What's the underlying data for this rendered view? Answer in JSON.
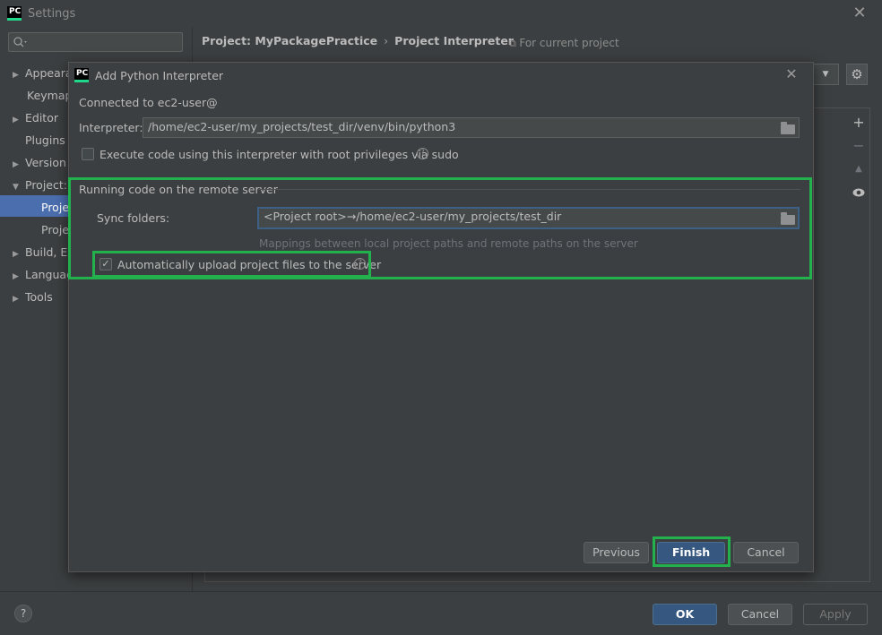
{
  "window": {
    "logo_text": "PC",
    "title": "Settings",
    "close_glyph": "✕"
  },
  "sidebar": {
    "items": [
      {
        "label": "Appeara",
        "arrow": "▶"
      },
      {
        "label": "Keymap",
        "arrow": ""
      },
      {
        "label": "Editor",
        "arrow": "▶"
      },
      {
        "label": "Plugins",
        "arrow": ""
      },
      {
        "label": "Version",
        "arrow": "▶"
      },
      {
        "label": "Project:",
        "arrow": "▼"
      },
      {
        "label": "Projec",
        "arrow": ""
      },
      {
        "label": "Projec",
        "arrow": ""
      },
      {
        "label": "Build, Ex",
        "arrow": "▶"
      },
      {
        "label": "Languag",
        "arrow": "▶"
      },
      {
        "label": "Tools",
        "arrow": "▶"
      }
    ]
  },
  "breadcrumb": {
    "project": "Project: MyPackagePractice",
    "separator": "›",
    "page": "Project Interpreter",
    "for_current": "For current project"
  },
  "dialog": {
    "logo_text": "PC",
    "title": "Add Python Interpreter",
    "connected": "Connected to ec2-user@",
    "interpreter_label": "Interpreter:",
    "interpreter_value": "/home/ec2-user/my_projects/test_dir/venv/bin/python3",
    "sudo_label": "Execute code using this interpreter with root privileges via sudo",
    "section_title": "Running code on the remote server",
    "sync_label": "Sync folders:",
    "sync_value": "<Project root>→/home/ec2-user/my_projects/test_dir",
    "mappings_hint": "Mappings between local project paths and remote paths on the server",
    "auto_upload_label": "Automatically upload project files to the server",
    "auto_upload_checked": true,
    "previous_label": "Previous",
    "finish_label": "Finish",
    "cancel_label": "Cancel"
  },
  "footer": {
    "help": "?",
    "ok_label": "OK",
    "cancel_label": "Cancel",
    "apply_label": "Apply"
  },
  "colors": {
    "highlight": "#22b14c",
    "primary_button": "#365880",
    "selection": "#4b6eaf"
  }
}
